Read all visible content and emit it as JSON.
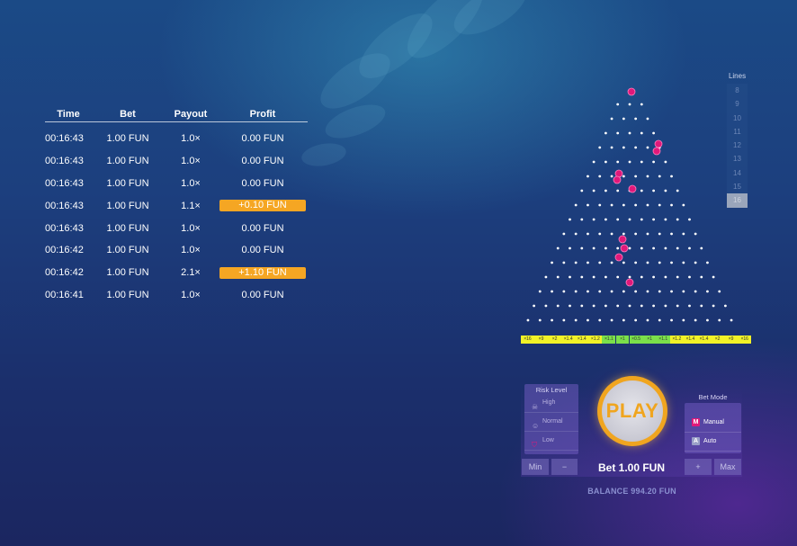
{
  "history": {
    "headers": {
      "time": "Time",
      "bet": "Bet",
      "payout": "Payout",
      "profit": "Profit"
    },
    "rows": [
      {
        "time": "00:16:43",
        "bet": "1.00 FUN",
        "payout": "1.0×",
        "profit": "0.00 FUN",
        "win": false
      },
      {
        "time": "00:16:43",
        "bet": "1.00 FUN",
        "payout": "1.0×",
        "profit": "0.00 FUN",
        "win": false
      },
      {
        "time": "00:16:43",
        "bet": "1.00 FUN",
        "payout": "1.0×",
        "profit": "0.00 FUN",
        "win": false
      },
      {
        "time": "00:16:43",
        "bet": "1.00 FUN",
        "payout": "1.1×",
        "profit": "+0.10 FUN",
        "win": true
      },
      {
        "time": "00:16:43",
        "bet": "1.00 FUN",
        "payout": "1.0×",
        "profit": "0.00 FUN",
        "win": false
      },
      {
        "time": "00:16:42",
        "bet": "1.00 FUN",
        "payout": "1.0×",
        "profit": "0.00 FUN",
        "win": false
      },
      {
        "time": "00:16:42",
        "bet": "1.00 FUN",
        "payout": "2.1×",
        "profit": "+1.10 FUN",
        "win": true
      },
      {
        "time": "00:16:41",
        "bet": "1.00 FUN",
        "payout": "1.0×",
        "profit": "0.00 FUN",
        "win": false
      }
    ]
  },
  "lines": {
    "title": "Lines",
    "options": [
      "8",
      "9",
      "10",
      "11",
      "12",
      "13",
      "14",
      "15",
      "16"
    ],
    "selected": "16"
  },
  "board": {
    "rows": 16,
    "multipliers": [
      "×16",
      "×9",
      "×2",
      "×1.4",
      "×1.4",
      "×1.2",
      "×1.1",
      "×1",
      "×0.5",
      "×1",
      "×1.1",
      "×1.2",
      "×1.4",
      "×1.4",
      "×2",
      "×9",
      "×16"
    ],
    "colors": {
      "peg": "#ffffff",
      "ball": "#e0197a",
      "slot_edge": "#f2f227",
      "slot_mid": "#7be04a"
    }
  },
  "risk": {
    "title": "Risk Level",
    "options": [
      {
        "label": "High",
        "icon": "skull-icon"
      },
      {
        "label": "Normal",
        "icon": "smile-icon"
      },
      {
        "label": "Low",
        "icon": "shield-icon"
      }
    ],
    "selected": "Low"
  },
  "bet_mode": {
    "title": "Bet Mode",
    "options": [
      {
        "label": "Manual",
        "tag": "M",
        "tag_color": "#e0197a"
      },
      {
        "label": "Auto",
        "tag": "A",
        "tag_color": "#9aa0c8"
      }
    ],
    "selected": "Manual"
  },
  "controls": {
    "min_label": "Min",
    "minus_label": "−",
    "plus_label": "+",
    "max_label": "Max",
    "play_label": "PLAY",
    "bet_label": "Bet 1.00 FUN",
    "balance_label": "BALANCE 994.20 FUN"
  },
  "accent": {
    "win": "#f5a623",
    "play": "#f0a51f"
  }
}
